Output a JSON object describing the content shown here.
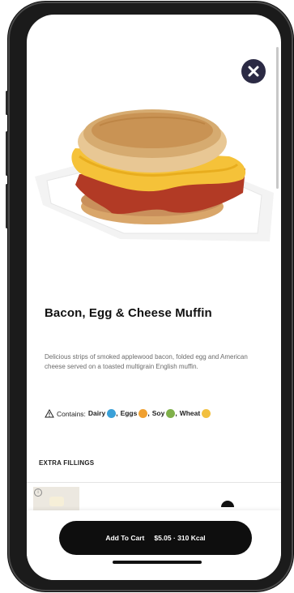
{
  "item": {
    "title": "Bacon, Egg & Cheese Muffin",
    "description": "Delicious strips of smoked applewood bacon, folded egg and American cheese served on a toasted multigrain English muffin.",
    "contains_label": "Contains:",
    "allergens": [
      {
        "name": "Dairy",
        "sep": ",",
        "color": "#3aa0d8"
      },
      {
        "name": "Eggs",
        "sep": ",",
        "color": "#f0a030"
      },
      {
        "name": "Soy",
        "sep": ",",
        "color": "#7fb04a"
      },
      {
        "name": "Wheat",
        "sep": "",
        "color": "#f2c040"
      }
    ]
  },
  "sections": {
    "extra_fillings": "EXTRA FILLINGS"
  },
  "cart": {
    "label": "Add To Cart",
    "price": "$5.05 · 310 Kcal"
  },
  "icons": {
    "close": "close-icon",
    "warning": "warning-icon",
    "info": "info-icon"
  },
  "colors": {
    "close_button": "#2b2a44",
    "cart_button": "#0e0e0e"
  }
}
